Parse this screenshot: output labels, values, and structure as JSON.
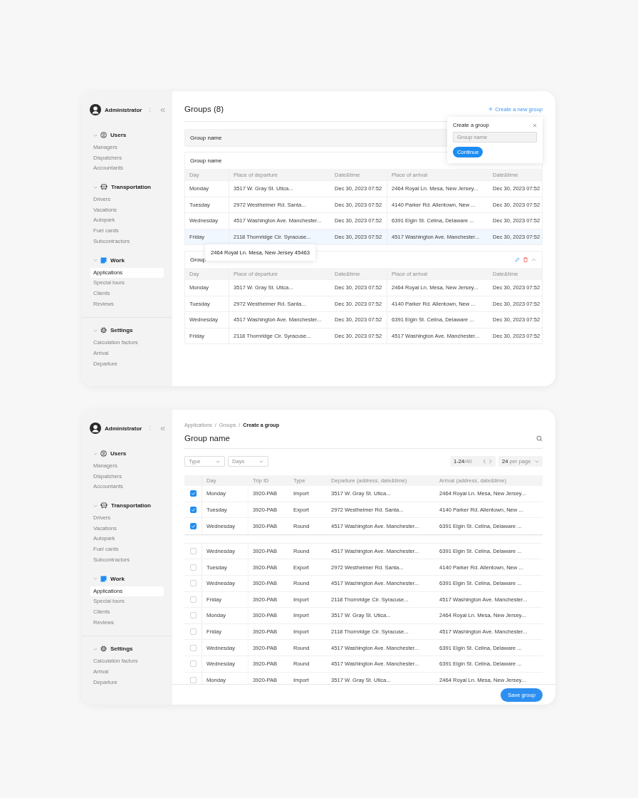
{
  "panels": [
    {
      "kind": "groups",
      "sidebar": {
        "user": "Administrator",
        "sections": [
          {
            "kind": "users",
            "title": "Users",
            "expanded": true,
            "items": [
              {
                "label": "Managers",
                "selected": false
              },
              {
                "label": "Dispatchers",
                "selected": false
              },
              {
                "label": "Accountants",
                "selected": false
              }
            ]
          },
          {
            "kind": "transport",
            "title": "Transportation",
            "expanded": true,
            "items": [
              {
                "label": "Drivers",
                "selected": false
              },
              {
                "label": "Vacations",
                "selected": false
              },
              {
                "label": "Autopark",
                "selected": false
              },
              {
                "label": "Fuel cards",
                "selected": false
              },
              {
                "label": "Subcontractors",
                "selected": false
              }
            ]
          },
          {
            "kind": "work",
            "title": "Work",
            "expanded": true,
            "items": [
              {
                "label": "Applications",
                "selected": true
              },
              {
                "label": "Special tours",
                "selected": false
              },
              {
                "label": "Clients",
                "selected": false
              },
              {
                "label": "Reviews",
                "selected": false
              }
            ]
          },
          {
            "kind": "settings",
            "title": "Settings",
            "expanded": true,
            "items": [
              {
                "label": "Calculation factors",
                "selected": false
              },
              {
                "label": "Arrival",
                "selected": false
              },
              {
                "label": "Departure",
                "selected": false
              }
            ]
          }
        ]
      },
      "main": {
        "title": "Groups (8)",
        "create_link": "Create a new group",
        "groups": [
          {
            "title": "Group name",
            "expanded": false
          },
          {
            "title": "Group name",
            "expanded": true,
            "columns": [
              "Day",
              "Place of departure",
              "Date&time",
              "Place of arrival",
              "Date&time"
            ],
            "rows": [
              {
                "hovered": false,
                "cells": [
                  "Monday",
                  "3517 W. Gray St. Utica...",
                  "Dec 30, 2023 07:52",
                  "2464 Royal Ln. Mesa, New Jersey...",
                  "Dec 30, 2023 07:52"
                ]
              },
              {
                "hovered": false,
                "cells": [
                  "Tuesday",
                  "2972 Westheimer Rd. Santa...",
                  "Dec 30, 2023 07:52",
                  "4140 Parker Rd. Allentown, New ...",
                  "Dec 30, 2023 07:52"
                ]
              },
              {
                "hovered": false,
                "cells": [
                  "Wednesday",
                  "4517 Washington Ave. Manchester...",
                  "Dec 30, 2023 07:52",
                  "6391 Elgin St. Celina, Delaware ...",
                  "Dec 30, 2023 07:52"
                ]
              },
              {
                "hovered": true,
                "cells": [
                  "Friday",
                  "2118 Thornridge Cir. Syracuse...",
                  "Dec 30, 2023 07:52",
                  "4517 Washington Ave. Manchester...",
                  "Dec 30, 2023 07:52"
                ]
              }
            ]
          },
          {
            "title": "Group",
            "expanded": true,
            "hovered": true,
            "columns": [
              "Day",
              "Place of departure",
              "Date&time",
              "Place of arrival",
              "Date&time"
            ],
            "rows": [
              {
                "hovered": false,
                "cells": [
                  "Monday",
                  "3517 W. Gray St. Utica...",
                  "Dec 30, 2023 07:52",
                  "2464 Royal Ln. Mesa, New Jersey...",
                  "Dec 30, 2023 07:52"
                ]
              },
              {
                "hovered": false,
                "cells": [
                  "Tuesday",
                  "2972 Westheimer Rd. Santa...",
                  "Dec 30, 2023 07:52",
                  "4140 Parker Rd. Allentown, New ...",
                  "Dec 30, 2023 07:52"
                ]
              },
              {
                "hovered": false,
                "cells": [
                  "Wednesday",
                  "4517 Washington Ave. Manchester...",
                  "Dec 30, 2023 07:52",
                  "6391 Elgin St. Celina, Delaware ...",
                  "Dec 30, 2023 07:52"
                ]
              },
              {
                "hovered": false,
                "cells": [
                  "Friday",
                  "2118 Thornridge Cir. Syracuse...",
                  "Dec 30, 2023 07:52",
                  "4517 Washington Ave. Manchester...",
                  "Dec 30, 2023 07:52"
                ]
              }
            ]
          }
        ],
        "tooltip": "2464 Royal Ln. Mesa, New Jersey 45463",
        "popover": {
          "title": "Create a group",
          "placeholder": "Group name",
          "button": "Continue"
        }
      }
    },
    {
      "kind": "group_editor",
      "sidebar": {
        "user": "Administrator",
        "sections": [
          {
            "kind": "users",
            "title": "Users",
            "expanded": true,
            "items": [
              {
                "label": "Managers",
                "selected": false
              },
              {
                "label": "Dispatchers",
                "selected": false
              },
              {
                "label": "Accountants",
                "selected": false
              }
            ]
          },
          {
            "kind": "transport",
            "title": "Transportation",
            "expanded": true,
            "items": [
              {
                "label": "Drivers",
                "selected": false
              },
              {
                "label": "Vacations",
                "selected": false
              },
              {
                "label": "Autopark",
                "selected": false
              },
              {
                "label": "Fuel cards",
                "selected": false
              },
              {
                "label": "Subcontractors",
                "selected": false
              }
            ]
          },
          {
            "kind": "work",
            "title": "Work",
            "expanded": true,
            "items": [
              {
                "label": "Applications",
                "selected": true
              },
              {
                "label": "Special tours",
                "selected": false
              },
              {
                "label": "Clients",
                "selected": false
              },
              {
                "label": "Reviews",
                "selected": false
              }
            ]
          },
          {
            "kind": "settings",
            "title": "Settings",
            "expanded": true,
            "items": [
              {
                "label": "Calculation factors",
                "selected": false
              },
              {
                "label": "Arrival",
                "selected": false
              },
              {
                "label": "Departure",
                "selected": false
              }
            ]
          }
        ]
      },
      "main": {
        "breadcrumb": {
          "separator": "/",
          "items": [
            {
              "label": "Applications",
              "current": false
            },
            {
              "label": "Groups",
              "current": false
            },
            {
              "label": "Create a group",
              "current": true
            }
          ]
        },
        "title": "Group name",
        "filters": [
          {
            "placeholder": "Type"
          },
          {
            "placeholder": "Days"
          }
        ],
        "pagination": "**1-24**/40",
        "per_page": "**24** per page",
        "table": {
          "columns": [
            "Day",
            "Trip ID",
            "Type",
            "Departure (address, date&time)",
            "Arrival (address, date&time)"
          ],
          "pinned_rows": [
            {
              "checked": true,
              "cells": [
                "Monday",
                "3920-PAB",
                "Import",
                "3517 W. Gray St. Utica...",
                "2464 Royal Ln. Mesa, New Jersey..."
              ]
            },
            {
              "checked": true,
              "cells": [
                "Tuesday",
                "3920-PAB",
                "Export",
                "2972 Westheimer Rd. Santa...",
                "4140 Parker Rd. Allentown, New ..."
              ]
            },
            {
              "checked": true,
              "cells": [
                "Wednesday",
                "3920-PAB",
                "Round",
                "4517 Washington Ave. Manchester...",
                "6391 Elgin St. Celina, Delaware ..."
              ]
            }
          ],
          "rows": [
            {
              "checked": false,
              "cells": [
                "Wednesday",
                "3920-PAB",
                "Round",
                "4517 Washington Ave. Manchester...",
                "6391 Elgin St. Celina, Delaware ..."
              ]
            },
            {
              "checked": false,
              "cells": [
                "Tuesday",
                "3920-PAB",
                "Export",
                "2972 Westheimer Rd. Santa...",
                "4140 Parker Rd. Allentown, New ..."
              ]
            },
            {
              "checked": false,
              "cells": [
                "Wednesday",
                "3920-PAB",
                "Round",
                "4517 Washington Ave. Manchester...",
                "6391 Elgin St. Celina, Delaware ..."
              ]
            },
            {
              "checked": false,
              "cells": [
                "Friday",
                "3920-PAB",
                "Import",
                "2118 Thornridge Cir. Syracuse...",
                "4517 Washington Ave. Manchester..."
              ]
            },
            {
              "checked": false,
              "cells": [
                "Monday",
                "3920-PAB",
                "Import",
                "3517 W. Gray St. Utica...",
                "2464 Royal Ln. Mesa, New Jersey..."
              ]
            },
            {
              "checked": false,
              "cells": [
                "Friday",
                "3920-PAB",
                "Import",
                "2118 Thornridge Cir. Syracuse...",
                "4517 Washington Ave. Manchester..."
              ]
            },
            {
              "checked": false,
              "cells": [
                "Wednesday",
                "3920-PAB",
                "Round",
                "4517 Washington Ave. Manchester...",
                "6391 Elgin St. Celina, Delaware ..."
              ]
            },
            {
              "checked": false,
              "cells": [
                "Wednesday",
                "3920-PAB",
                "Round",
                "4517 Washington Ave. Manchester...",
                "6391 Elgin St. Celina, Delaware ..."
              ]
            },
            {
              "checked": false,
              "cells": [
                "Monday",
                "3920-PAB",
                "Import",
                "3517 W. Gray St. Utica...",
                "2464 Royal Ln. Mesa, New Jersey..."
              ]
            }
          ]
        },
        "save_button": "Save group"
      }
    }
  ]
}
